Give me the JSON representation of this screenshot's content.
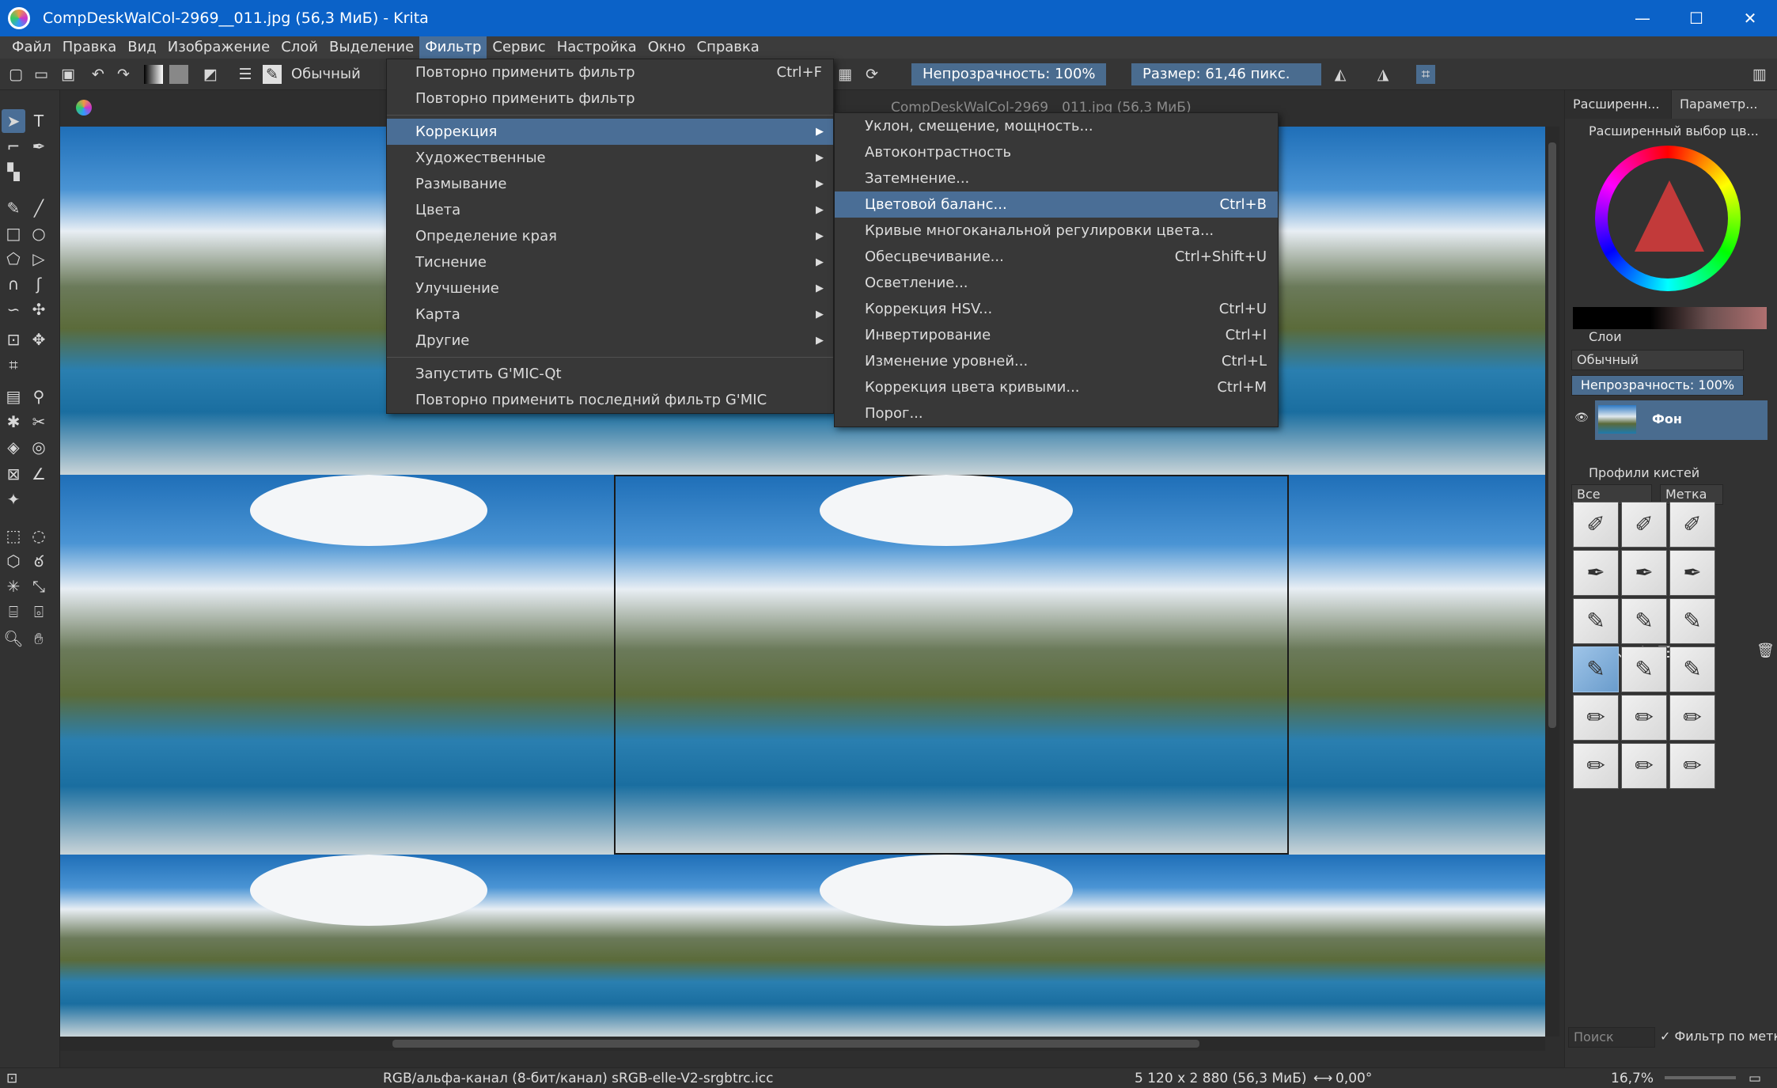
{
  "window": {
    "title": "CompDeskWalCol-2969__011.jpg (56,3 МиБ) - Krita",
    "minimize": "—",
    "maximize": "☐",
    "close": "✕"
  },
  "menubar": [
    "Файл",
    "Правка",
    "Вид",
    "Изображение",
    "Слой",
    "Выделение",
    "Фильтр",
    "Сервис",
    "Настройка",
    "Окно",
    "Справка"
  ],
  "toolbar": {
    "blend_mode": "Обычный",
    "opacity": "Непрозрачность: 100%",
    "size": "Размер: 61,46 пикс."
  },
  "document": {
    "tab_title": "CompDeskWalCol-2969__011.jpg (56,3 МиБ)",
    "close": "✕"
  },
  "filter_menu": {
    "items": [
      {
        "label": "Повторно применить фильтр",
        "shortcut": "Ctrl+F"
      },
      {
        "label": "Повторно применить фильтр",
        "shortcut": ""
      },
      {
        "label": "Коррекция",
        "submenu": true
      },
      {
        "label": "Художественные",
        "submenu": true
      },
      {
        "label": "Размывание",
        "submenu": true
      },
      {
        "label": "Цвета",
        "submenu": true
      },
      {
        "label": "Определение края",
        "submenu": true
      },
      {
        "label": "Тиснение",
        "submenu": true
      },
      {
        "label": "Улучшение",
        "submenu": true
      },
      {
        "label": "Карта",
        "submenu": true
      },
      {
        "label": "Другие",
        "submenu": true
      },
      {
        "label": "Запустить G'MIC-Qt",
        "shortcut": ""
      },
      {
        "label": "Повторно применить последний фильтр G'MIC",
        "shortcut": ""
      }
    ]
  },
  "correction_submenu": {
    "items": [
      {
        "label": "Уклон, смещение, мощность...",
        "shortcut": ""
      },
      {
        "label": "Автоконтрастность",
        "shortcut": ""
      },
      {
        "label": "Затемнение...",
        "shortcut": ""
      },
      {
        "label": "Цветовой баланс...",
        "shortcut": "Ctrl+B"
      },
      {
        "label": "Кривые многоканальной регулировки цвета...",
        "shortcut": ""
      },
      {
        "label": "Обесцвечивание...",
        "shortcut": "Ctrl+Shift+U"
      },
      {
        "label": "Осветление...",
        "shortcut": ""
      },
      {
        "label": "Коррекция HSV...",
        "shortcut": "Ctrl+U"
      },
      {
        "label": "Инвертирование",
        "shortcut": "Ctrl+I"
      },
      {
        "label": "Изменение уровней...",
        "shortcut": "Ctrl+L"
      },
      {
        "label": "Коррекция цвета кривыми...",
        "shortcut": "Ctrl+M"
      },
      {
        "label": "Порог...",
        "shortcut": ""
      }
    ]
  },
  "dock": {
    "tab_advanced": "Расширенн...",
    "tab_params": "Параметр...",
    "color_panel_title": "Расширенный выбор цв...",
    "layers_title": "Слои",
    "layers_blend": "Обычный",
    "layers_opacity": "Непрозрачность: 100%",
    "layer_name": "Фон",
    "brushes_title": "Профили кистей",
    "brush_filter": "Все",
    "brush_tag": "Метка",
    "search_placeholder": "Поиск",
    "filter_by_tag": "Фильтр по метке"
  },
  "statusbar": {
    "colorspace": "RGB/альфа-канал (8-бит/канал)  sRGB-elle-V2-srgbtrc.icc",
    "dimensions": "5 120 x 2 880 (56,3 МиБ)",
    "rotation": "0,00°",
    "zoom": "16,7%"
  },
  "colors": {
    "titlebar": "#0b62c8",
    "highlight": "#4a6e96",
    "panel": "#323232"
  }
}
